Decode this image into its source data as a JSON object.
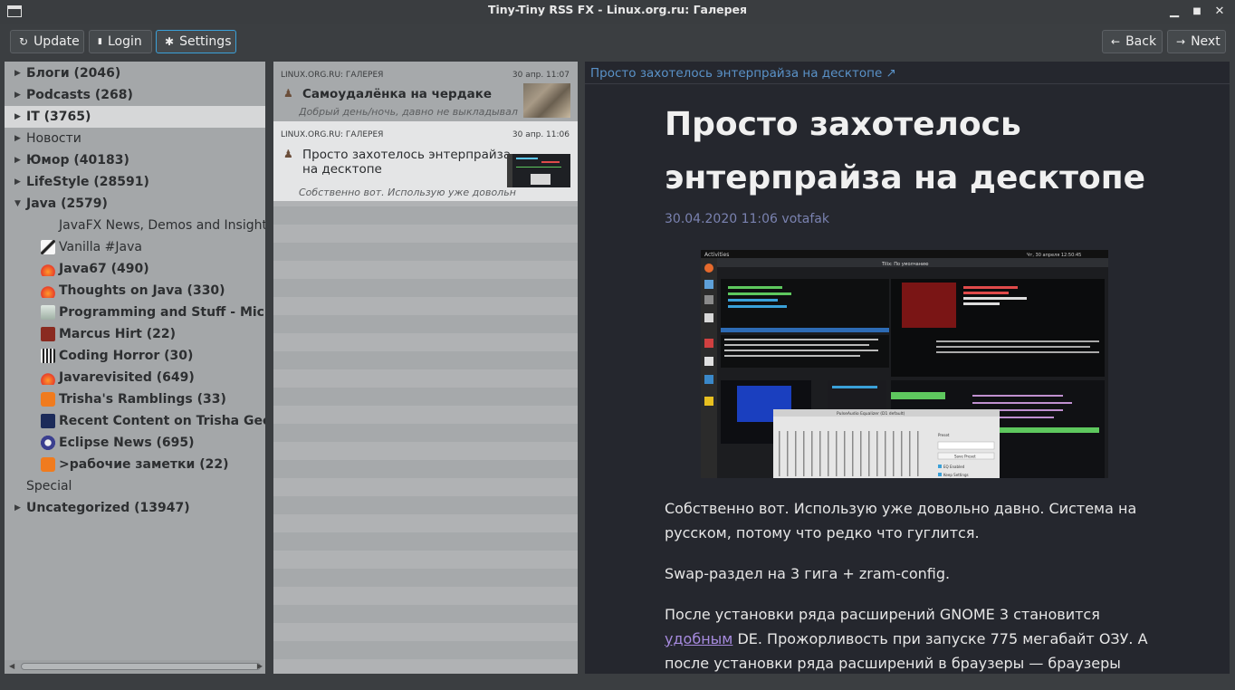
{
  "window": {
    "title": "Tiny-Tiny RSS FX - Linux.org.ru: Галерея",
    "controls": {
      "minimize": "▁",
      "maximize": "■",
      "close": "✕"
    }
  },
  "toolbar": {
    "update_label": "Update",
    "login_label": "Login",
    "settings_label": "Settings",
    "back_label": "Back",
    "next_label": "Next",
    "icons": {
      "update": "↻",
      "login": "▮",
      "settings": "✱",
      "back": "←",
      "next": "→"
    }
  },
  "tree": {
    "items": [
      {
        "label": "Блоги (2046)",
        "bold": true,
        "arrow": "▶",
        "indent": 0
      },
      {
        "label": "Podcasts (268)",
        "bold": true,
        "arrow": "▶",
        "indent": 0
      },
      {
        "label": "IT (3765)",
        "bold": true,
        "arrow": "▶",
        "indent": 0,
        "selected": true
      },
      {
        "label": "Новости",
        "bold": false,
        "arrow": "▶",
        "indent": 0
      },
      {
        "label": "Юмор (40183)",
        "bold": true,
        "arrow": "▶",
        "indent": 0
      },
      {
        "label": "LifeStyle (28591)",
        "bold": true,
        "arrow": "▶",
        "indent": 0
      },
      {
        "label": "Java (2579)",
        "bold": true,
        "arrow": "▼",
        "indent": 0
      },
      {
        "label": "JavaFX News, Demos and Insight // FX",
        "bold": false,
        "arrow": "",
        "indent": 1,
        "icon": "none"
      },
      {
        "label": "Vanilla #Java",
        "bold": false,
        "arrow": "",
        "indent": 1,
        "icon": "vanilla"
      },
      {
        "label": "Java67 (490)",
        "bold": true,
        "arrow": "",
        "indent": 1,
        "icon": "flame"
      },
      {
        "label": "Thoughts on Java (330)",
        "bold": true,
        "arrow": "",
        "indent": 1,
        "icon": "flame"
      },
      {
        "label": "Programming and Stuff - Michael",
        "bold": true,
        "arrow": "",
        "indent": 1,
        "icon": "prog"
      },
      {
        "label": "Marcus Hirt (22)",
        "bold": true,
        "arrow": "",
        "indent": 1,
        "icon": "marcus"
      },
      {
        "label": "Coding Horror (30)",
        "bold": true,
        "arrow": "",
        "indent": 1,
        "icon": "horror"
      },
      {
        "label": "Javarevisited (649)",
        "bold": true,
        "arrow": "",
        "indent": 1,
        "icon": "flame"
      },
      {
        "label": "Trisha's Ramblings (33)",
        "bold": true,
        "arrow": "",
        "indent": 1,
        "icon": "blogger"
      },
      {
        "label": "Recent Content on Trisha Gee (",
        "bold": true,
        "arrow": "",
        "indent": 1,
        "icon": "trisha"
      },
      {
        "label": "Eclipse News (695)",
        "bold": true,
        "arrow": "",
        "indent": 1,
        "icon": "eclipse"
      },
      {
        "label": ">рабочие заметки (22)",
        "bold": true,
        "arrow": "",
        "indent": 1,
        "icon": "blogger"
      },
      {
        "label": "Special",
        "bold": false,
        "arrow": "",
        "indent": 0
      },
      {
        "label": "Uncategorized (13947)",
        "bold": true,
        "arrow": "▶",
        "indent": 0
      }
    ],
    "scroll": {
      "left": "◀",
      "right": "▶"
    }
  },
  "articles": [
    {
      "feed": "LINUX.ORG.RU: ГАЛЕРЕЯ",
      "date": "30 апр. 11:07",
      "title": "Самоудалёнка на чердаке",
      "excerpt": "Добрый день/ночь, давно не выкладывал ни...",
      "unread": true
    },
    {
      "feed": "LINUX.ORG.RU: ГАЛЕРЕЯ",
      "date": "30 апр. 11:06",
      "title_line1": "Просто захотелось энтерпрайза",
      "title_line2": "на десктопе",
      "excerpt": "Собственно вот. Использую уже довольно...",
      "unread": false,
      "selected": true
    }
  ],
  "article": {
    "link_text": "Просто захотелось энтерпрайза на десктопе ↗",
    "heading": "Просто захотелось энтерпрайза на десктопе",
    "meta": "30.04.2020 11:06 votafak",
    "p1": "Собственно вот. Использую уже довольно давно. Система на русском, потому что редко что гуглится.",
    "p2": "Swap-раздел на 3 гига + zram-config.",
    "p3_before": "После установки ряда расширений GNOME 3 становится ",
    "p3_link": "удобным",
    "p3_after": " DE. Прожорливость при запуске 775 мегабайт ОЗУ. А после установки ряда расширений в браузеры — браузеры"
  },
  "screenshot": {
    "topbar_left": "Activities",
    "topbar_right": "Чт, 30 апреля 12:50:45",
    "term_title": "Tilix: По умолчанию",
    "eq_title": "PulseAudio Equalizer (D1 default)",
    "eq_preset_label": "Preset",
    "eq_save_label": "Save Preset",
    "eq_check1": "EQ Enabled",
    "eq_check2": "Keep Settings"
  },
  "colors": {
    "accent": "#3aa0d8",
    "tree_bg": "#a4a7a9",
    "tree_selected": "#d6d7d8",
    "list_selected": "#e4e5e6",
    "content_bg": "#25272e",
    "link": "#5a92c8",
    "meta": "#7a82b0",
    "visited_link": "#a78bdf"
  }
}
